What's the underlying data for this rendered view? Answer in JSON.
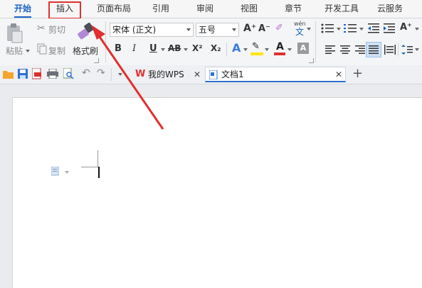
{
  "menu": {
    "tabs": [
      {
        "label": "开始",
        "active": true
      },
      {
        "label": "插入",
        "active": false,
        "highlighted": true
      },
      {
        "label": "页面布局",
        "active": false
      },
      {
        "label": "引用",
        "active": false
      },
      {
        "label": "审阅",
        "active": false
      },
      {
        "label": "视图",
        "active": false
      },
      {
        "label": "章节",
        "active": false
      },
      {
        "label": "开发工具",
        "active": false
      },
      {
        "label": "云服务",
        "active": false
      }
    ]
  },
  "ribbon": {
    "paste_label": "粘贴",
    "cut_label": "剪切",
    "copy_label": "复制",
    "format_painter_label": "格式刷",
    "font_name": "宋体 (正文)",
    "font_size": "五号",
    "bold": "B",
    "italic": "I",
    "underline": "U",
    "strikethrough": "AB",
    "superscript": "X²",
    "subscript": "X₂",
    "phonetic_top": "wén",
    "phonetic_bottom": "文"
  },
  "quickbar": {
    "wps_tab_label": "我的WPS",
    "doc_tab_label": "文档1",
    "new_tab_symbol": "+"
  },
  "colors": {
    "accent_blue": "#1b63c6",
    "highlight_red": "#e0302f",
    "highlight_yellow": "#ffe600",
    "font_red": "#e0302f"
  }
}
